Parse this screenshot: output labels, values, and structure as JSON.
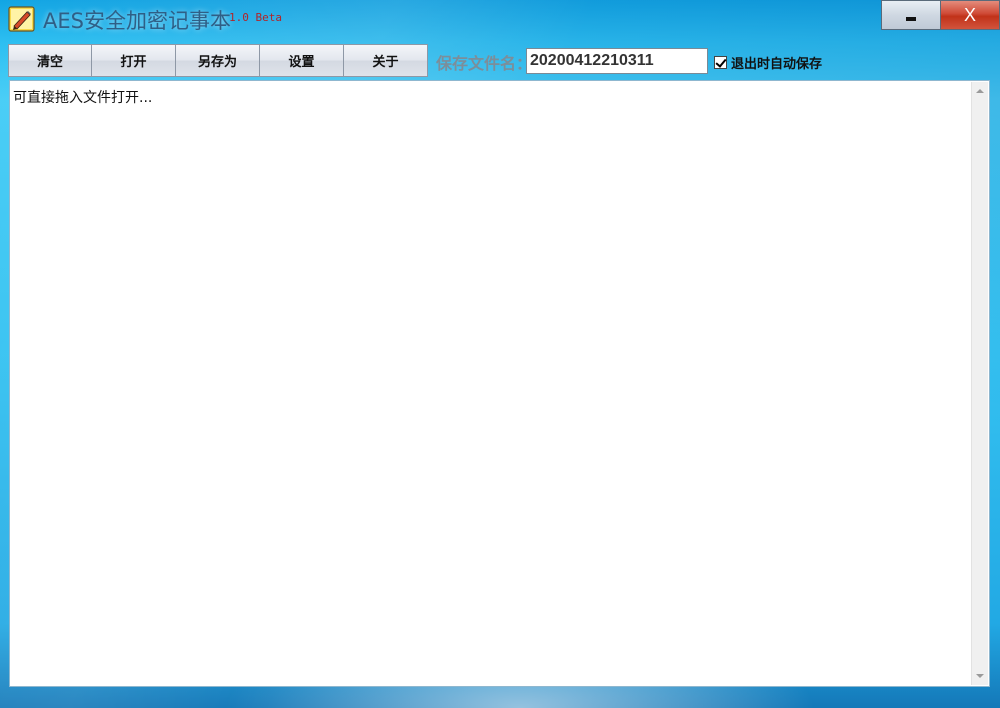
{
  "window": {
    "title": "AES安全加密记事本",
    "version": "1.0 Beta",
    "minimize_icon": "minimize-icon",
    "close_label": "X",
    "app_icon": "notepad-pencil-icon"
  },
  "toolbar": {
    "buttons": [
      "清空",
      "打开",
      "另存为",
      "设置",
      "关于"
    ],
    "filename_label": "保存文件名：",
    "filename_value": "20200412210311",
    "autosave_label": "退出时自动保存",
    "autosave_checked": true
  },
  "editor": {
    "placeholder": "可直接拖入文件打开..."
  },
  "colors": {
    "title_text": "#2f5f86",
    "version_text": "#b0252a",
    "close_button": "#c13219",
    "background": "#35c2f1"
  }
}
